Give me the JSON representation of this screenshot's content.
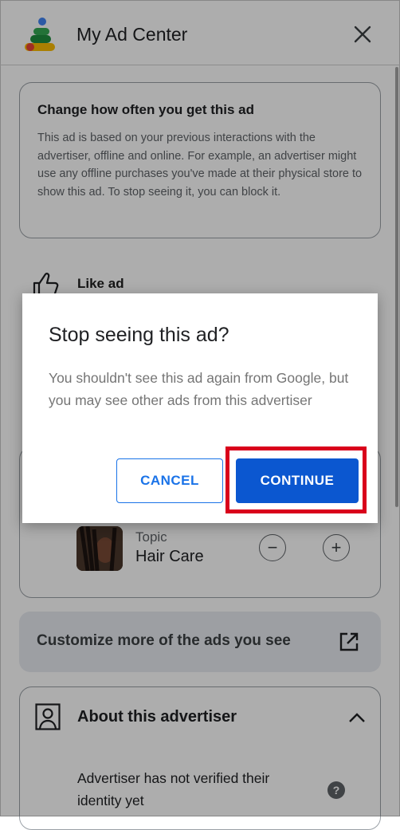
{
  "header": {
    "title": "My Ad Center",
    "close_icon": "close-icon"
  },
  "info_card": {
    "title": "Change how often you get this ad",
    "body": "This ad is based on your previous interactions with the advertiser, offline and online. For example, an advertiser might use any offline purchases you've made at their physical store to show this ad. To stop seeing it, you can block it."
  },
  "like": {
    "label": "Like ad",
    "icon": "thumbs-up-icon"
  },
  "topic": {
    "label": "Topic",
    "name": "Hair Care",
    "minus": "−",
    "plus": "+"
  },
  "customize": {
    "label": "Customize more of the ads you see",
    "icon": "open-external-icon"
  },
  "about": {
    "title": "About this advertiser",
    "text": "Advertiser has not verified their identity yet",
    "help": "?"
  },
  "dialog": {
    "title": "Stop seeing this ad?",
    "body": "You shouldn't see this ad again from Google, but you may see other ads from this advertiser",
    "cancel_label": "CANCEL",
    "continue_label": "CONTINUE"
  },
  "colors": {
    "primary": "#0b57d0",
    "highlight": "#d9001b",
    "scrim": "rgba(0,0,0,0.32)"
  }
}
